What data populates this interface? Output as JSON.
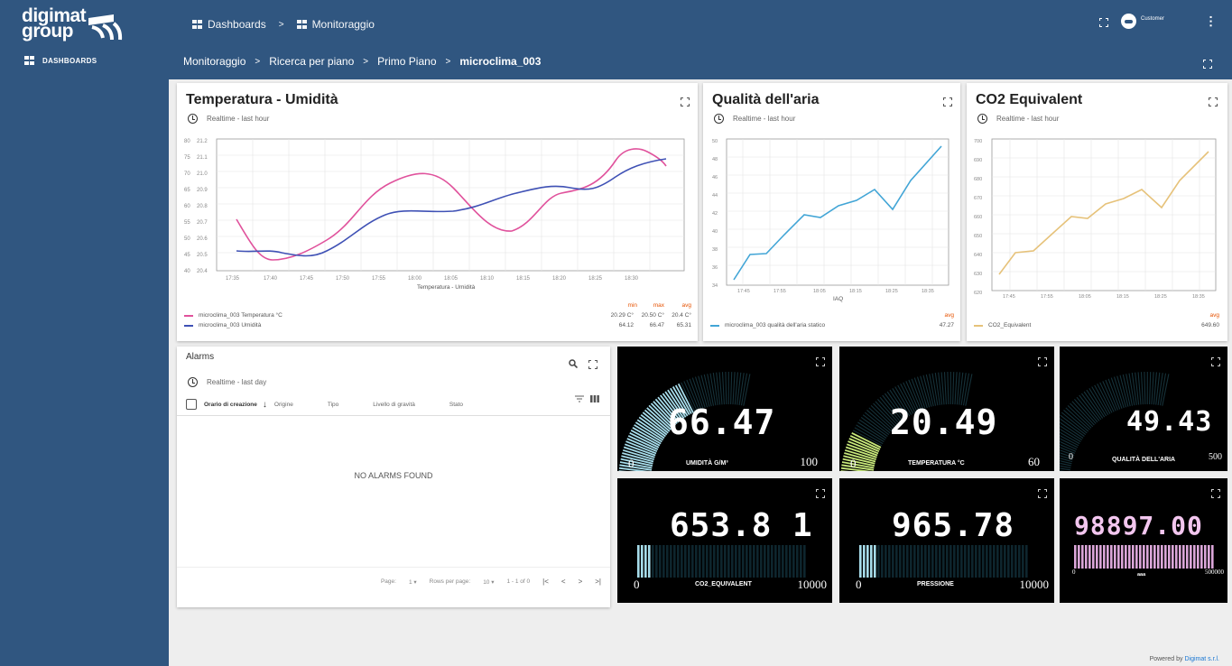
{
  "app": {
    "brand_line1": "digimat",
    "brand_line2": "group",
    "user_name": "Customer"
  },
  "sidebar": {
    "items": [
      {
        "label": "DASHBOARDS"
      }
    ]
  },
  "header": {
    "crumbs_top": [
      "Dashboards",
      "Monitoraggio"
    ],
    "crumbs": [
      "Monitoraggio",
      "Ricerca per piano",
      "Primo Piano",
      "microclima_003"
    ]
  },
  "temp_card": {
    "title": "Temperatura - Umidità",
    "timewindow": "Realtime - last hour",
    "x_label": "Temperatura - Umidità",
    "legend_headers": [
      "min",
      "max",
      "avg"
    ],
    "legend": [
      {
        "name": "microclima_003 Temperatura °C",
        "color": "#e0529c",
        "min": "20.29 C°",
        "max": "20.50 C°",
        "avg": "20.4 C°"
      },
      {
        "name": "microclima_003 Umidità",
        "color": "#3f51b5",
        "min": "64.12",
        "max": "66.47",
        "avg": "65.31"
      }
    ]
  },
  "air_card": {
    "title": "Qualità dell'aria",
    "timewindow": "Realtime - last hour",
    "x_label": "IAQ",
    "legend_header": "avg",
    "legend": [
      {
        "name": "microclima_003 qualità dell'aria statico",
        "color": "#42a5d6",
        "avg": "47.27"
      }
    ]
  },
  "co2_card": {
    "title": "CO2 Equivalent",
    "timewindow": "Realtime - last hour",
    "legend_header": "avg",
    "legend": [
      {
        "name": "CO2_Equivalent",
        "color": "#e6c27a",
        "avg": "649.60"
      }
    ]
  },
  "alarms": {
    "title": "Alarms",
    "timewindow": "Realtime - last day",
    "columns": [
      "Orario di creazione",
      "Origine",
      "Tipo",
      "Livello di gravità",
      "Stato"
    ],
    "empty_text": "NO ALARMS FOUND",
    "pager": [
      "Page:",
      "1 ▾",
      "Rows per page:",
      "10 ▾",
      "1 - 1 of 0",
      "|<",
      "<",
      ">",
      ">|"
    ]
  },
  "gauges": [
    {
      "value": "66.47",
      "label": "UMIDITÀ G/M³",
      "min": "0",
      "max": "100",
      "fraction": 0.6647,
      "color": "#a6dcea"
    },
    {
      "value": "20.49",
      "label": "TEMPERATURA °C",
      "min": "0",
      "max": "60",
      "fraction": 0.34,
      "color": "#c7e87a"
    },
    {
      "value": "49.43",
      "label": "QUALITÀ DELL'ARIA",
      "min": "0",
      "max": "500",
      "fraction": 0.099,
      "color": "#e8e8e8"
    }
  ],
  "bars": [
    {
      "value": "653.8 1",
      "label": "CO2_EQUIVALENT",
      "min": "0",
      "max": "10000",
      "fraction": 0.065,
      "color": "#a6dcea"
    },
    {
      "value": "965.78",
      "label": "PRESSIONE",
      "min": "0",
      "max": "10000",
      "fraction": 0.097,
      "color": "#a6dcea"
    },
    {
      "value": "98897.00",
      "label": "aaa",
      "min": "0",
      "max": "500000",
      "fraction": 0.198,
      "color": "#dba6d9"
    }
  ],
  "footer": {
    "text": "Powered by ",
    "link": "Digimat s.r.l."
  },
  "colors": {
    "header": "#305680",
    "background": "#eeeeee"
  }
}
